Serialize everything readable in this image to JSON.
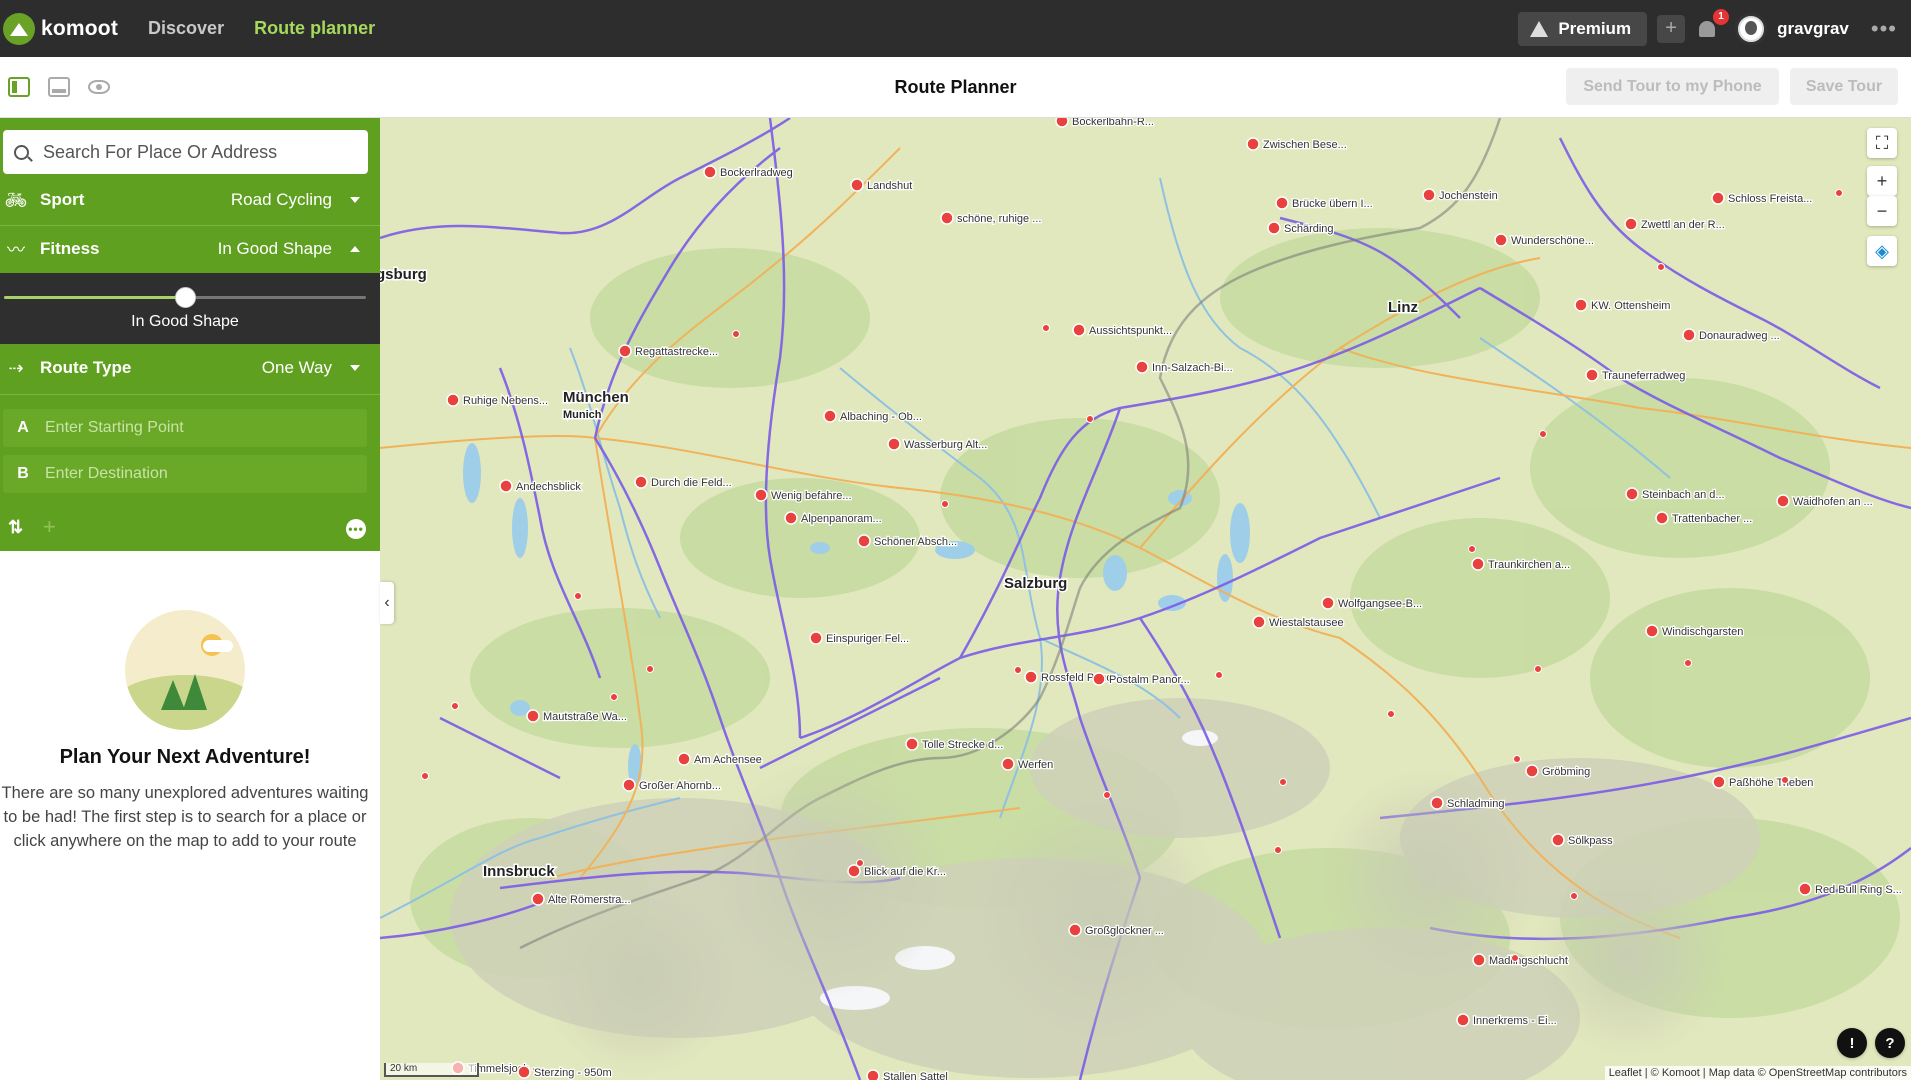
{
  "app": {
    "logo_text": "komoot",
    "nav": {
      "discover": "Discover",
      "route_planner": "Route planner"
    },
    "premium_label": "Premium",
    "notification_count": "1",
    "username": "gravgrav",
    "more": "•••"
  },
  "toolbar": {
    "title": "Route Planner",
    "send_label": "Send Tour to my Phone",
    "save_label": "Save Tour"
  },
  "sidebar": {
    "search_placeholder": "Search For Place Or Address",
    "sport": {
      "label": "Sport",
      "value": "Road Cycling"
    },
    "fitness": {
      "label": "Fitness",
      "value": "In Good Shape",
      "slider_label": "In Good Shape",
      "level": 0.5
    },
    "route_type": {
      "label": "Route Type",
      "value": "One Way"
    },
    "start": {
      "letter": "A",
      "placeholder": "Enter Starting Point"
    },
    "destination": {
      "letter": "B",
      "placeholder": "Enter Destination"
    },
    "empty_title": "Plan Your Next Adventure!",
    "empty_text": "There are so many unexplored adventures waiting to be had! The first step is to search for a place or click anywhere on the map to add to your route"
  },
  "map": {
    "cities": [
      "München",
      "Munich",
      "Salzburg",
      "Innsbruck",
      "gsburg",
      "Linz"
    ],
    "pois": [
      "Bockerlbahn-R...",
      "Zwischen Bese...",
      "Bockerlradweg",
      "Landshut",
      "schöne, ruhige ...",
      "Brücke übern I...",
      "Jochenstein",
      "Schärding",
      "Wunderschöne...",
      "Schloss Freista...",
      "Zwettl an der R...",
      "KW. Ottensheim",
      "Aussichtspunkt...",
      "Inn-Salzach-Bi...",
      "Donauradweg ...",
      "Regattastrecke...",
      "Ruhige Nebens...",
      "Trauneferradweg",
      "Albaching - Ob...",
      "Wasserburg Alt...",
      "Andechsblick",
      "Durch die Feld...",
      "Wenig befahre...",
      "Alpenpanoram...",
      "Steinbach an d...",
      "Waidhofen an ...",
      "Trattenbacher ...",
      "Schöner Absch...",
      "Traunkirchen a...",
      "Wolfgangsee-B...",
      "Wiestalstausee",
      "Einspuriger Fel...",
      "Windischgarsten",
      "Rossfeld Panor...",
      "Postalm Panor...",
      "Maut­straße Wa...",
      "Am Achensee",
      "Tolle Strecke d...",
      "Werfen",
      "Gröbming",
      "Paßhöhe Trieben",
      "Großer Ahornb...",
      "Schladming",
      "Sölkpass",
      "Blick auf die Kr...",
      "Alte Römerstra...",
      "Red Bull Ring S...",
      "Großglockner ...",
      "Madlingschlucht",
      "Innerkrems - Ei...",
      "Timmelsjoch - ...",
      "Sterzing - 950m",
      "Stallen Sattel"
    ],
    "scale_label": "20 km",
    "attribution": "Leaflet | © Komoot | Map data © OpenStreetMap contributors",
    "zoom_in": "+",
    "zoom_out": "−",
    "report": "!",
    "help": "?",
    "collapse": "‹"
  },
  "colors": {
    "accent": "#60a021",
    "nav_active": "#a5d95b",
    "topbar": "#2d2d2d",
    "route_lines": "#7b5ce8"
  }
}
